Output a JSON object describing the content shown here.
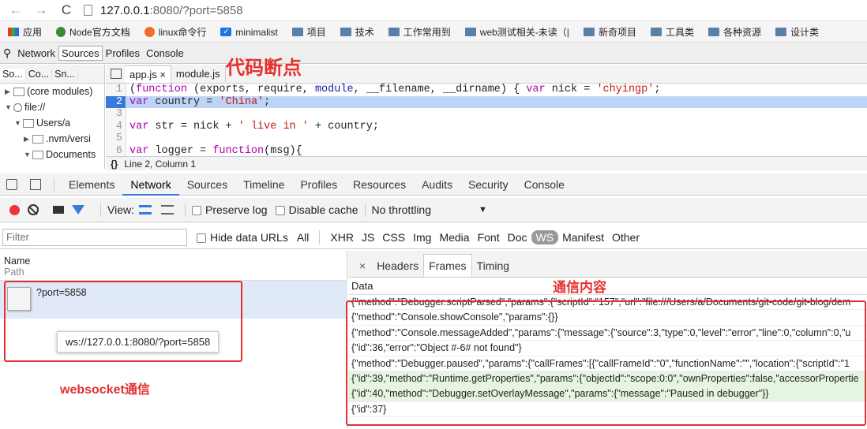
{
  "browser": {
    "url_host": "127.0.0.1",
    "url_rest": ":8080/?port=5858",
    "bookmarks": [
      "应用",
      "Node官方文档",
      "linux命令行",
      "minimalist",
      "项目",
      "技术",
      "工作常用到",
      "web测试相关-未读（|",
      "新奇项目",
      "工具类",
      "各种资源",
      "设计类"
    ]
  },
  "top_toolbar": {
    "items": [
      "Network",
      "Sources",
      "Profiles",
      "Console"
    ]
  },
  "navigator": {
    "tabs": [
      "So...",
      "Co...",
      "Sn..."
    ],
    "tree": [
      "(core modules)",
      "file://",
      "Users/a",
      ".nvm/versi",
      "Documents"
    ]
  },
  "editor": {
    "tabs": [
      "app.js",
      "module.js"
    ],
    "close": "×",
    "lines": [
      {
        "n": "1",
        "html": "(<span class='kw'>function</span> (exports, require, <span class='var'>module</span>, __filename, __dirname) { <span class='kw'>var</span> nick = <span class='str'>'chyingp'</span>;"
      },
      {
        "n": "2",
        "html": "<span class='kw'>var</span> country = <span class='str'>'China'</span>;"
      },
      {
        "n": "3",
        "html": ""
      },
      {
        "n": "4",
        "html": "<span class='kw'>var</span> str = nick + <span class='str'>' live in '</span> + country;"
      },
      {
        "n": "5",
        "html": ""
      },
      {
        "n": "6",
        "html": "<span class='kw'>var</span> logger = <span class='kw'>function</span>(msg){"
      }
    ],
    "status_braces": "{}",
    "status": "Line 2, Column 1"
  },
  "devtools": {
    "tabs": [
      "Elements",
      "Network",
      "Sources",
      "Timeline",
      "Profiles",
      "Resources",
      "Audits",
      "Security",
      "Console"
    ]
  },
  "network_toolbar": {
    "view_label": "View:",
    "preserve_log": "Preserve log",
    "disable_cache": "Disable cache",
    "throttling": "No throttling",
    "throttle_arrow": "▼"
  },
  "filter": {
    "placeholder": "Filter",
    "hide_data_urls": "Hide data URLs",
    "types": [
      "All",
      "XHR",
      "JS",
      "CSS",
      "Img",
      "Media",
      "Font",
      "Doc",
      "WS",
      "Manifest",
      "Other"
    ]
  },
  "requests": {
    "col_name": "Name",
    "col_path": "Path",
    "row_name": "?port=5858",
    "tooltip": "ws://127.0.0.1:8080/?port=5858"
  },
  "detail": {
    "close": "×",
    "tabs": [
      "Headers",
      "Frames",
      "Timing"
    ],
    "data_head": "Data",
    "frames": [
      {
        "t": "{\"method\":\"Debugger.scriptParsed\",\"params\":{\"scriptId\":\"157\",\"url\":\"file:///Users/a/Documents/git-code/git-blog/dem",
        "g": false
      },
      {
        "t": "{\"method\":\"Console.showConsole\",\"params\":{}}",
        "g": false
      },
      {
        "t": "{\"method\":\"Console.messageAdded\",\"params\":{\"message\":{\"source\":3,\"type\":0,\"level\":\"error\",\"line\":0,\"column\":0,\"u",
        "g": false
      },
      {
        "t": "{\"id\":36,\"error\":\"Object #-6# not found\"}",
        "g": false
      },
      {
        "t": "{\"method\":\"Debugger.paused\",\"params\":{\"callFrames\":[{\"callFrameId\":\"0\",\"functionName\":\"\",\"location\":{\"scriptId\":\"1",
        "g": false
      },
      {
        "t": "{\"id\":39,\"method\":\"Runtime.getProperties\",\"params\":{\"objectId\":\"scope:0:0\",\"ownProperties\":false,\"accessorPropertie",
        "g": true
      },
      {
        "t": "{\"id\":40,\"method\":\"Debugger.setOverlayMessage\",\"params\":{\"message\":\"Paused in debugger\"}}",
        "g": true
      },
      {
        "t": "{\"id\":37}",
        "g": false
      }
    ]
  },
  "annotations": {
    "breakpoint": "代码断点",
    "content": "通信内容",
    "ws": "websocket通信"
  }
}
